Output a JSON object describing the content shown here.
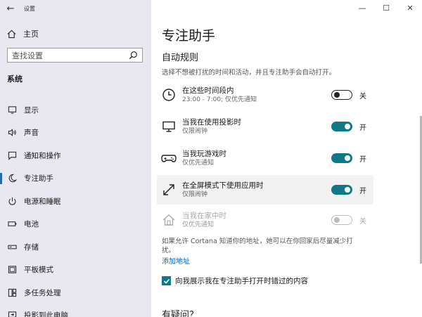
{
  "window": {
    "title": "设置",
    "minimize": "—",
    "maximize": "☐",
    "close": "✕",
    "back": "←"
  },
  "sidebar": {
    "home": "主页",
    "search_placeholder": "查找设置",
    "section": "系统",
    "items": [
      {
        "label": "显示",
        "icon": "display-icon"
      },
      {
        "label": "声音",
        "icon": "speaker-icon"
      },
      {
        "label": "通知和操作",
        "icon": "notification-icon"
      },
      {
        "label": "专注助手",
        "icon": "moon-icon",
        "active": true
      },
      {
        "label": "电源和睡眠",
        "icon": "power-icon"
      },
      {
        "label": "电池",
        "icon": "battery-icon"
      },
      {
        "label": "存储",
        "icon": "storage-icon"
      },
      {
        "label": "平板模式",
        "icon": "tablet-icon"
      },
      {
        "label": "多任务处理",
        "icon": "multitask-icon"
      },
      {
        "label": "投影到此电脑",
        "icon": "project-icon"
      }
    ]
  },
  "main": {
    "title": "专注助手",
    "subtitle": "自动规则",
    "description": "选择不想被打扰的时间和活动，并且专注助手会自动打开。",
    "rules": [
      {
        "name": "在这些时间段内",
        "sub": "23:00 - 7:00; 仅优先通知",
        "state": "关",
        "on": false
      },
      {
        "name": "当我在使用投影时",
        "sub": "仅限闹钟",
        "state": "开",
        "on": true
      },
      {
        "name": "当我玩游戏时",
        "sub": "仅优先通知",
        "state": "开",
        "on": true
      },
      {
        "name": "在全屏模式下使用应用时",
        "sub": "仅限闹钟",
        "state": "开",
        "on": true
      },
      {
        "name": "当我在家中时",
        "sub": "仅优先通知",
        "state": "关",
        "on": false
      }
    ],
    "cortana_note": "如果允许 Cortana 知道你的地址，她可以在你回家后尽量减少打扰。",
    "add_address": "添加地址",
    "show_summary": "向我展示我在专注助手打开时错过的内容",
    "help_title": "有疑问？"
  },
  "colors": {
    "accent": "#0f7a85",
    "link": "#0063b1",
    "sidebar": "#e9e7ef"
  }
}
